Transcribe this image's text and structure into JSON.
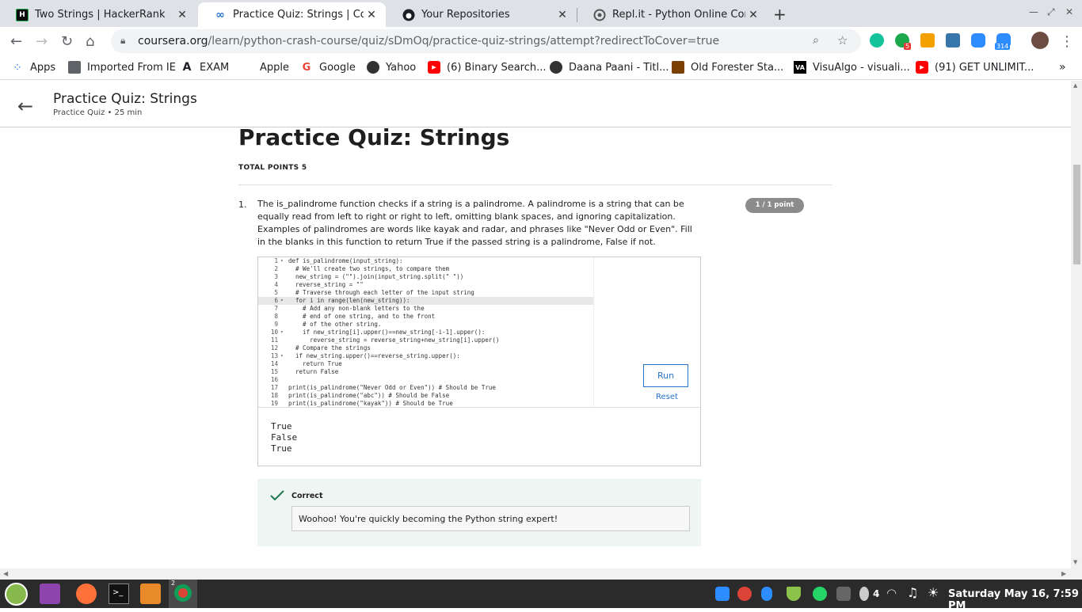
{
  "browser": {
    "tabs": [
      {
        "title": "Two Strings | HackerRank",
        "icon": "hackerrank-icon"
      },
      {
        "title": "Practice Quiz: Strings | Course",
        "icon": "coursera-icon"
      },
      {
        "title": "Your Repositories",
        "icon": "github-icon"
      },
      {
        "title": "Repl.it - Python Online Compil",
        "icon": "replit-icon"
      }
    ],
    "url_host": "coursera.org",
    "url_path": "/learn/python-crash-course/quiz/sDmOq/practice-quiz-strings/attempt?redirectToCover=true",
    "ext_badges": {
      "grammarly_count": "5",
      "zoom_count": "314"
    },
    "bookmarks": [
      "Apps",
      "Imported From IE",
      "EXAM",
      "Apple",
      "Google",
      "Yahoo",
      "(6) Binary Search...",
      "Daana Paani - Titl...",
      "Old Forester Sta...",
      "VisuAlgo - visuali...",
      "(91) GET UNLIMIT..."
    ]
  },
  "header": {
    "title": "Practice Quiz: Strings",
    "subtitle": "Practice Quiz • 25 min"
  },
  "quiz": {
    "title": "Practice Quiz: Strings",
    "total_points": "TOTAL POINTS 5",
    "question_number": "1.",
    "question_text": "The is_palindrome function checks if a string is a palindrome. A palindrome is a string that can be equally read from left to right or right to left, omitting blank spaces, and ignoring capitalization. Examples of palindromes are words like kayak and radar, and phrases like \"Never Odd or Even\". Fill in the blanks in this function to return True if the passed string is a palindrome, False if not.",
    "points_badge": "1 / 1 point",
    "run_label": "Run",
    "reset_label": "Reset",
    "code_lines": [
      {
        "n": "1",
        "f": "▾",
        "t": "def is_palindrome(input_string):"
      },
      {
        "n": "2",
        "f": "",
        "t": "  # We'll create two strings, to compare them"
      },
      {
        "n": "3",
        "f": "",
        "t": "  new_string = (\"\").join(input_string.split(\" \"))"
      },
      {
        "n": "4",
        "f": "",
        "t": "  reverse_string = \"\""
      },
      {
        "n": "5",
        "f": "",
        "t": "  # Traverse through each letter of the input string"
      },
      {
        "n": "6",
        "f": "▾",
        "t": "  for i in range(len(new_string)):"
      },
      {
        "n": "7",
        "f": "",
        "t": "    # Add any non-blank letters to the"
      },
      {
        "n": "8",
        "f": "",
        "t": "    # end of one string, and to the front"
      },
      {
        "n": "9",
        "f": "",
        "t": "    # of the other string."
      },
      {
        "n": "10",
        "f": "▾",
        "t": "    if new_string[i].upper()==new_string[-i-1].upper():"
      },
      {
        "n": "11",
        "f": "",
        "t": "      reverse_string = reverse_string+new_string[i].upper()"
      },
      {
        "n": "12",
        "f": "",
        "t": "  # Compare the strings"
      },
      {
        "n": "13",
        "f": "▾",
        "t": "  if new_string.upper()==reverse_string.upper():"
      },
      {
        "n": "14",
        "f": "",
        "t": "    return True"
      },
      {
        "n": "15",
        "f": "",
        "t": "  return False"
      },
      {
        "n": "16",
        "f": "",
        "t": ""
      },
      {
        "n": "17",
        "f": "",
        "t": "print(is_palindrome(\"Never Odd or Even\")) # Should be True"
      },
      {
        "n": "18",
        "f": "",
        "t": "print(is_palindrome(\"abc\")) # Should be False"
      },
      {
        "n": "19",
        "f": "",
        "t": "print(is_palindrome(\"kayak\")) # Should be True"
      }
    ],
    "output": [
      "True",
      "False",
      "True"
    ],
    "feedback_title": "Correct",
    "feedback_message": "Woohoo! You're quickly becoming the Python string expert!"
  },
  "taskbar": {
    "workspace_badge": "2",
    "tray_count": "4",
    "clock": "Saturday May 16, 7:59 PM"
  },
  "colors": {
    "link": "#2a73cc",
    "correct": "#1d7a4e",
    "badge": "#8c8c8c"
  }
}
